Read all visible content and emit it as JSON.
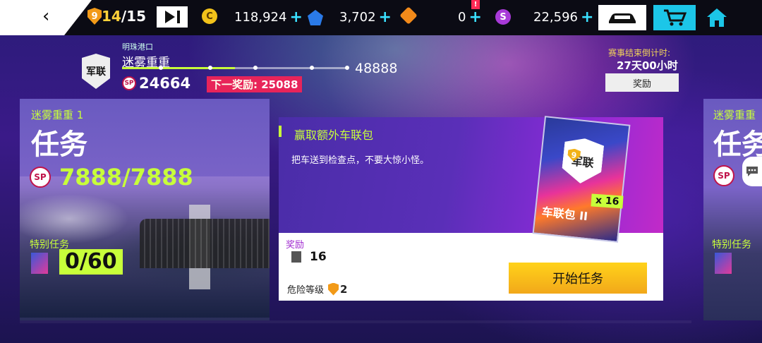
{
  "topbar": {
    "back_icon": "chevron-left-icon",
    "fuel_current": "14",
    "fuel_max": "/15",
    "fuel_shield_number": "9",
    "credits_symbol": "C",
    "credits": "118,924",
    "tokens": "3,702",
    "blueprint_count": "0",
    "notification_mark": "!",
    "s_currency_symbol": "S",
    "s_currency": "22,596",
    "plus": "+"
  },
  "season": {
    "subtitle": "明珠港口",
    "name": "迷雾重重",
    "badge_text": "军联",
    "sp_label": "SP",
    "sp_value": "24664",
    "next_reward_label": "下一奖励:",
    "next_reward_value": "25088",
    "goal_value": "48888",
    "progress": 0.5,
    "countdown_label": "赛事结束倒计时:",
    "countdown_value": "27天00小时",
    "reward_button": "奖励"
  },
  "left_card": {
    "subtitle": "迷雾重重 1",
    "title": "任务",
    "sp_label": "SP",
    "sp_progress": "7888/7888",
    "special_label": "特别任务",
    "special_count": "0/60"
  },
  "mission": {
    "title": "赢取额外车联包",
    "description": "把车送到检查点，不要大惊小怪。",
    "pack_logo": "军联",
    "pack_rank": "9",
    "pack_name": "车联包 II",
    "pack_quantity": "x 16",
    "reward_label": "奖励",
    "reward_quantity": "16",
    "danger_label": "危险等级",
    "danger_level": "2",
    "start_button": "开始任务"
  },
  "right_card": {
    "subtitle": "迷雾重重",
    "title": "任务",
    "sp_label": "SP",
    "special_label": "特别任务"
  },
  "colors": {
    "accent_green": "#c8ff3a",
    "gold": "#ffd21a",
    "pink": "#e8245a",
    "cyan": "#1cc6e8"
  }
}
